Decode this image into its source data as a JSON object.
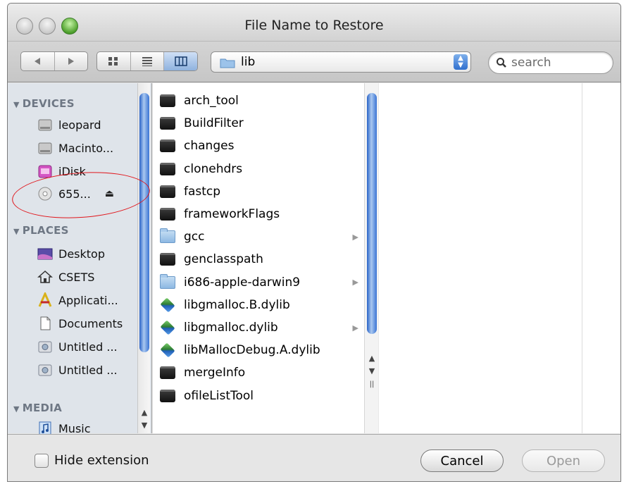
{
  "window": {
    "title": "File Name to Restore"
  },
  "toolbar": {
    "back_icon": "back-arrow-icon",
    "forward_icon": "forward-arrow-icon",
    "view_icons": [
      "icon-view-icon",
      "list-view-icon",
      "column-view-icon"
    ],
    "active_view": "column-view-icon",
    "path": "lib",
    "search_placeholder": "search"
  },
  "sidebar": {
    "sections": [
      {
        "label": "DEVICES",
        "items": [
          {
            "label": "leopard",
            "icon": "hard-drive-icon"
          },
          {
            "label": "Macinto...",
            "icon": "hard-drive-icon"
          },
          {
            "label": "iDisk",
            "icon": "idisk-icon"
          },
          {
            "label": "655...",
            "icon": "disc-icon",
            "eject": "⏏"
          }
        ]
      },
      {
        "label": "PLACES",
        "items": [
          {
            "label": "Desktop",
            "icon": "desktop-icon"
          },
          {
            "label": "CSETS",
            "icon": "home-icon"
          },
          {
            "label": "Applicati...",
            "icon": "applications-icon"
          },
          {
            "label": "Documents",
            "icon": "document-icon"
          },
          {
            "label": "Untitled ...",
            "icon": "disk-image-icon"
          },
          {
            "label": "Untitled ...",
            "icon": "disk-image-icon"
          }
        ]
      },
      {
        "label": "MEDIA",
        "items": [
          {
            "label": "Music",
            "icon": "music-icon"
          }
        ]
      }
    ]
  },
  "browser": {
    "column1": [
      {
        "name": "arch_tool",
        "kind": "exec"
      },
      {
        "name": "BuildFilter",
        "kind": "exec"
      },
      {
        "name": "changes",
        "kind": "exec"
      },
      {
        "name": "clonehdrs",
        "kind": "exec"
      },
      {
        "name": "fastcp",
        "kind": "exec"
      },
      {
        "name": "frameworkFlags",
        "kind": "exec"
      },
      {
        "name": "gcc",
        "kind": "folder",
        "has_children": true
      },
      {
        "name": "genclasspath",
        "kind": "exec"
      },
      {
        "name": "i686-apple-darwin9",
        "kind": "folder",
        "has_children": true
      },
      {
        "name": "libgmalloc.B.dylib",
        "kind": "lib"
      },
      {
        "name": "libgmalloc.dylib",
        "kind": "alias-lib",
        "has_children": true
      },
      {
        "name": "libMallocDebug.A.dylib",
        "kind": "lib"
      },
      {
        "name": "mergeInfo",
        "kind": "exec"
      },
      {
        "name": "ofileListTool",
        "kind": "exec"
      }
    ]
  },
  "footer": {
    "hide_extension_label": "Hide extension",
    "hide_extension_checked": false,
    "cancel_label": "Cancel",
    "open_label": "Open",
    "open_enabled": false
  },
  "colors": {
    "selection_blue": "#3a74d4",
    "annotation_red": "#e0151b",
    "sidebar_bg": "#dfe4ea"
  }
}
